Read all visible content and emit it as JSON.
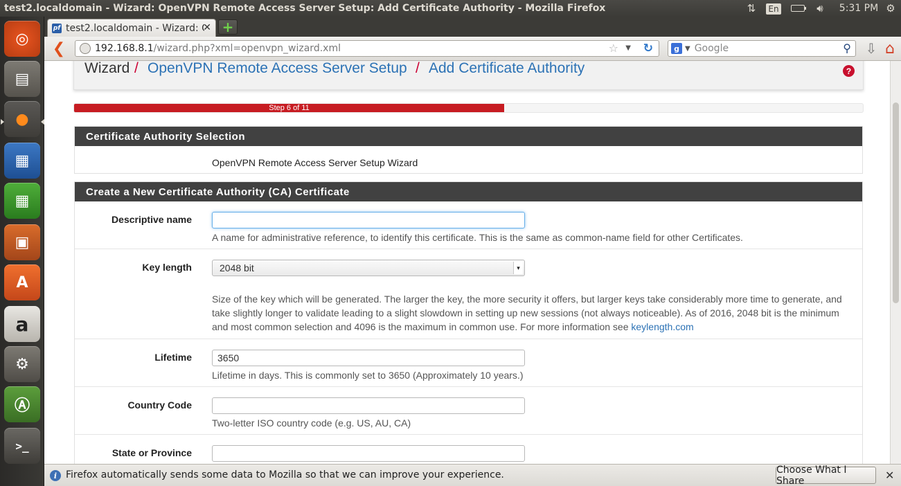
{
  "os": {
    "window_title": "test2.localdomain - Wizard: OpenVPN Remote Access Server Setup: Add Certificate Authority - Mozilla Firefox",
    "tray": {
      "network_icon": "network-arrows-icon",
      "language": "En",
      "battery_icon": "battery-icon",
      "volume_icon": "volume-icon",
      "clock": "5:31 PM",
      "settings_icon": "gear-icon"
    },
    "launcher": [
      {
        "name": "ubuntu-dash",
        "icon": "ubuntu-logo-icon"
      },
      {
        "name": "files",
        "icon": "file-cabinet-icon"
      },
      {
        "name": "firefox",
        "icon": "firefox-icon"
      },
      {
        "name": "libreoffice-writer",
        "icon": "writer-document-icon"
      },
      {
        "name": "libreoffice-calc",
        "icon": "calc-spreadsheet-icon"
      },
      {
        "name": "libreoffice-impress",
        "icon": "impress-presentation-icon"
      },
      {
        "name": "ubuntu-software-center",
        "icon": "shopping-bag-icon"
      },
      {
        "name": "amazon",
        "icon": "amazon-icon"
      },
      {
        "name": "system-settings",
        "icon": "wrench-gear-icon"
      },
      {
        "name": "software-updater",
        "icon": "updater-icon"
      },
      {
        "name": "terminal",
        "icon": "terminal-icon"
      }
    ]
  },
  "browser": {
    "tab": {
      "title": "test2.localdomain - Wizard: O...",
      "close": "✕"
    },
    "new_tab": "+",
    "url": {
      "host": "192.168.8.1",
      "path": "/wizard.php?xml=openvpn_wizard.xml"
    },
    "search": {
      "engine": "g",
      "placeholder": "Google"
    },
    "notification": {
      "text": "Firefox automatically sends some data to Mozilla so that we can improve your experience.",
      "button": "Choose What I Share",
      "close": "✕"
    }
  },
  "page": {
    "breadcrumb": {
      "root": "Wizard",
      "separator": "/",
      "section": "OpenVPN Remote Access Server Setup",
      "current": "Add Certificate Authority"
    },
    "help_icon": "?",
    "progress": {
      "label": "Step 6 of 11",
      "fraction": 0.545
    },
    "ca_selection": {
      "heading": "Certificate Authority Selection",
      "text": "OpenVPN Remote Access Server Setup Wizard"
    },
    "new_ca": {
      "heading": "Create a New Certificate Authority (CA) Certificate",
      "fields": {
        "descriptive_name": {
          "label": "Descriptive name",
          "value": "",
          "help": "A name for administrative reference, to identify this certificate. This is the same as common-name field for other Certificates."
        },
        "key_length": {
          "label": "Key length",
          "value": "2048 bit",
          "help_before_link": "Size of the key which will be generated. The larger the key, the more security it offers, but larger keys take considerably more time to generate, and take slightly longer to validate leading to a slight slowdown in setting up new sessions (not always noticeable). As of 2016, 2048 bit is the minimum and most common selection and 4096 is the maximum in common use. For more information see ",
          "help_link": "keylength.com"
        },
        "lifetime": {
          "label": "Lifetime",
          "value": "3650",
          "help": "Lifetime in days. This is commonly set to 3650 (Approximately 10 years.)"
        },
        "country_code": {
          "label": "Country Code",
          "value": "",
          "help": "Two-letter ISO country code (e.g. US, AU, CA)"
        },
        "state": {
          "label": "State or Province",
          "value": ""
        }
      }
    }
  }
}
